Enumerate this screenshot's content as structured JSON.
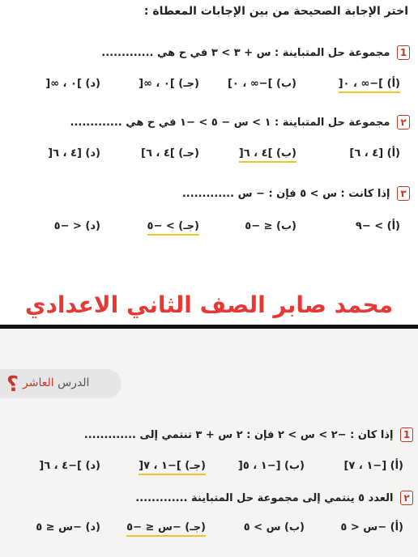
{
  "top": {
    "instruction": "اختر الإجابة الصحيحة من بين الإجابات المعطاة :",
    "q1": {
      "num": "1",
      "text": "مجموعة حل المتباينة : س + ٣ > ٣ في ح هي .............",
      "options": [
        "(أ) ]−∞ ، ٠[",
        "(ب) ]−∞ ، ٠]",
        "(جـ) ]٠ ، ∞[",
        "(د) ]٠ ، ∞["
      ]
    },
    "q2": {
      "num": "٢",
      "text": "مجموعة حل المتباينة : ١ > س − ٥ > −١ في ح هي .............",
      "options": [
        "(أ) [٤ ، ٦]",
        "(ب) ]٤ ، ٦[",
        "(جـ) ]٤ ، ٦]",
        "(د) [٤ ، ٦["
      ]
    },
    "q3": {
      "num": "٣",
      "text": "إذا كانت : س > ٥ فإن : − س .............",
      "options": [
        "(أ) > −٩",
        "(ب) ≤ −٥",
        "(جـ) > −٥",
        "(د) < −٥"
      ]
    }
  },
  "watermark": "محمد صابر الصف الثاني الاعدادي",
  "lesson": {
    "label": "الدرس",
    "ordinal": "العاشر",
    "mark": "؟"
  },
  "bottom": {
    "q1": {
      "num": "1",
      "text": "إذا كان : −٢ > س > ٢ فإن : ٢ س + ٣ تنتمي إلى .............",
      "options": [
        "(أ) [−١ ، ٧]",
        "(ب) [−١ ، ٥[",
        "(جـ) ]−١ ، ٧[",
        "(د) ]−٤ ، ٦["
      ]
    },
    "q2": {
      "num": "٢",
      "text": "العدد ٥ ينتمي إلى مجموعة حل المتباينة .............",
      "options": [
        "(أ) −س < ٥",
        "(ب) س > ٥",
        "(جـ) −س ≤ −٥",
        "(د) −س ≤ ٥"
      ]
    }
  },
  "colors": {
    "accent": "#c0392b",
    "underline": "#e8c72a",
    "watermark": "#e53935"
  }
}
